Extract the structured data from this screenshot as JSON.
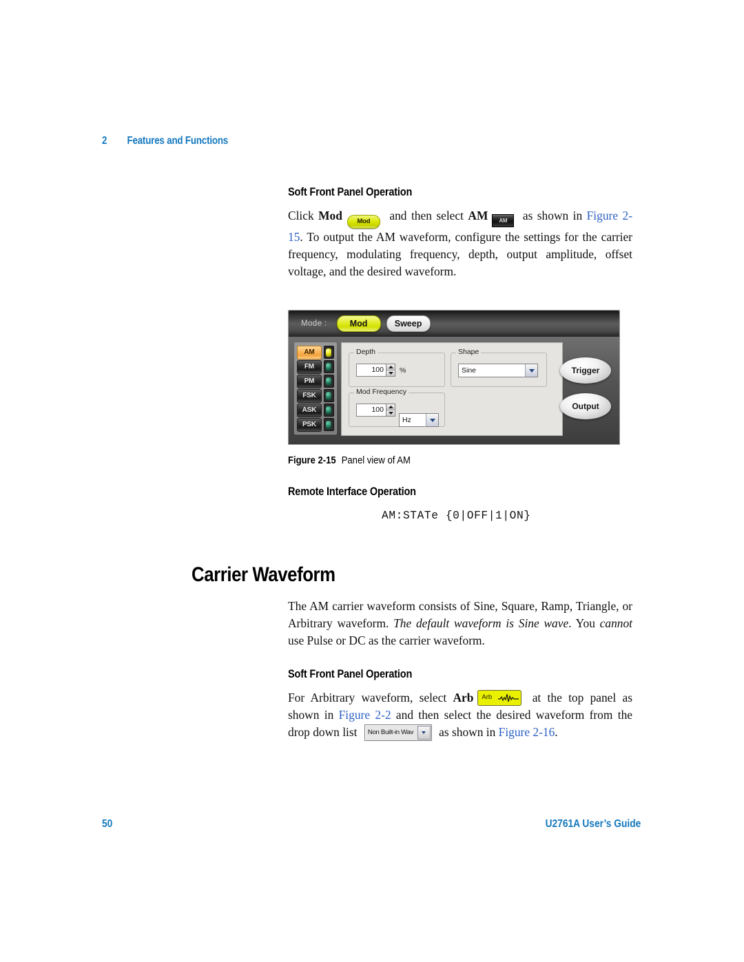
{
  "running_head": {
    "chapter_number": "2",
    "chapter_title": "Features and Functions"
  },
  "sections": {
    "sfp_heading_1": "Soft Front Panel Operation",
    "para_1": {
      "t1": "Click ",
      "b1": "Mod",
      "chip1": "Mod",
      "t2": " and then select ",
      "b2": "AM",
      "chip2": "AM",
      "t3": " as shown in ",
      "link1": "Figure 2-15",
      "t4": ". To output the AM waveform, configure the settings for the carrier frequency, modulating frequency, depth, output amplitude, offset voltage, and the desired waveform."
    },
    "figure_caption": {
      "label": "Figure 2-15",
      "text": "Panel view of AM"
    },
    "remote_heading": "Remote Interface Operation",
    "scpi_command": "AM:STATe {0|OFF|1|ON}",
    "chapter_title": "Carrier Waveform",
    "para_2": {
      "t1": "The AM carrier waveform consists of Sine, Square, Ramp, Triangle, or Arbitrary waveform. ",
      "i1": "The default waveform is Sine wave",
      "t2": ". You ",
      "i2": "cannot",
      "t3": " use Pulse or DC as the carrier waveform."
    },
    "sfp_heading_2": "Soft Front Panel Operation",
    "para_3": {
      "t1": "For Arbitrary waveform, select ",
      "b1": "Arb",
      "chip_arb": "Arb",
      "t2": " at the top panel as shown in ",
      "link1": "Figure 2-2",
      "t3": " and then select the desired waveform from the drop down list ",
      "chip_dropdown": "Non Built-in Wav",
      "t4": " as shown in ",
      "link2": "Figure 2-16",
      "t5": "."
    }
  },
  "panel": {
    "mode_label": "Mode :",
    "mode_buttons": [
      {
        "label": "Mod",
        "active": true
      },
      {
        "label": "Sweep",
        "active": false
      }
    ],
    "modulation_types": [
      {
        "label": "AM",
        "active": true,
        "led": "lit"
      },
      {
        "label": "FM",
        "active": false,
        "led": "dim"
      },
      {
        "label": "PM",
        "active": false,
        "led": "dim"
      },
      {
        "label": "FSK",
        "active": false,
        "led": "dim"
      },
      {
        "label": "ASK",
        "active": false,
        "led": "dim"
      },
      {
        "label": "PSK",
        "active": false,
        "led": "dim"
      }
    ],
    "depth": {
      "group_label": "Depth",
      "value": "100",
      "unit": "%"
    },
    "mod_frequency": {
      "group_label": "Mod Frequency",
      "value": "100",
      "unit": "Hz"
    },
    "shape": {
      "group_label": "Shape",
      "value": "Sine"
    },
    "action_buttons": [
      {
        "label": "Trigger"
      },
      {
        "label": "Output"
      }
    ]
  },
  "footer": {
    "page_number": "50",
    "guide_title": "U2761A User’s Guide"
  },
  "colors": {
    "accent_blue": "#1278be",
    "link_blue": "#2b5fc4",
    "highlight_yellow": "#e9f000",
    "active_orange": "#f2a23c"
  }
}
